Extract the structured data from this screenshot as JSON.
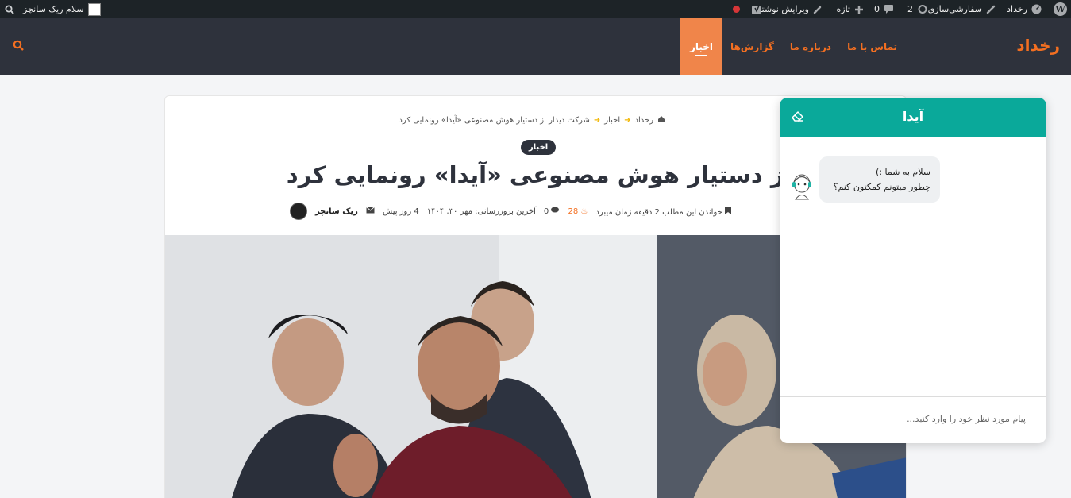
{
  "adminbar": {
    "site_name": "رخداد",
    "customize": "سفارشی‌سازی",
    "updates_count": "2",
    "comments_count": "0",
    "new_label": "تازه",
    "edit_post": "ویرایش نوشته",
    "greeting": "سلام ریک سانچز",
    "wp_logo_letter": "W"
  },
  "header": {
    "logo": "رخداد",
    "nav": [
      "اخبار",
      "گزارش‌ها",
      "درباره ما",
      "تماس با ما"
    ]
  },
  "article": {
    "breadcrumb": [
      "رخداد",
      "اخبار",
      "شرکت دیدار از دستیار هوش مصنوعی «آیدا» رونمایی کرد"
    ],
    "category": "اخبار",
    "title": "شرکت دیدار از دستیار هوش مصنوعی «آیدا» رونمایی کرد",
    "author": "ریک سانچز",
    "posted": "4 روز پیش",
    "updated": "آخرین بروزرسانی: مهر ۳۰, ۱۴۰۴",
    "comments": "0",
    "views": "28",
    "read_time": "خواندن این مطلب 2 دقیقه زمان میبرد"
  },
  "chat": {
    "title": "آیدا",
    "message_line1": "سلام به شما :)",
    "message_line2": "چطور میتونم کمکتون کنم؟",
    "input_placeholder": "پیام مورد نظر خود را وارد کنید..."
  },
  "colors": {
    "accent": "#f36f21",
    "header_bg": "#2e323c",
    "chat_header": "#0aa99a",
    "adminbar_bg": "#1d2327"
  }
}
